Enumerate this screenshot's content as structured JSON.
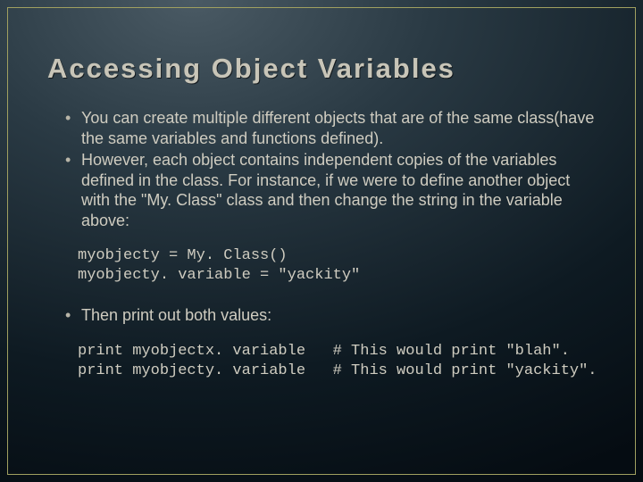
{
  "title": "Accessing Object Variables",
  "bullets1": [
    "You can create multiple different objects that are of the same class(have the same variables and functions defined).",
    "However, each object contains independent copies of the variables defined in the class. For instance, if we were to define another object with the \"My. Class\" class and then change the string in the variable above:"
  ],
  "code1": "myobjecty = My. Class()\nmyobjecty. variable = \"yackity\"",
  "bullets2": [
    "Then print out both values:"
  ],
  "code2": "print myobjectx. variable   # This would print \"blah\".\nprint myobjecty. variable   # This would print \"yackity\"."
}
